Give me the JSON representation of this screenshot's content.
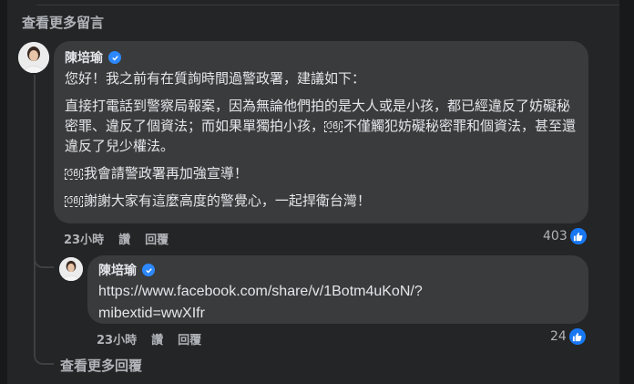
{
  "header": {
    "view_more_comments": "查看更多留言"
  },
  "comment": {
    "author": "陳培瑜",
    "greeting": "您好！我之前有在質詢時間過警政署，建議如下：",
    "para1": "直接打電話到警察局報案，因為無論他們拍的是大人或是小孩，都已經違反了妨礙秘密罪、違反了個資法；而如果單獨拍小孩，",
    "para1_tail": "不僅觸犯妨礙秘密罪和個資法，甚至還違反了兒少權法。",
    "para2": "我會請警政署再加強宣導！",
    "para3": "謝謝大家有這麼高度的警覺心，一起捍衛台灣！",
    "ob_glyph": "OBJ",
    "time": "23小時",
    "like_label": "讚",
    "reply_label": "回覆",
    "reaction_count": "403"
  },
  "reply": {
    "author": "陳培瑜",
    "link_line1": "https://www.facebook.com/share/v/1Botm4uKoN/?",
    "link_line2": "mibextid=wwXIfr",
    "time": "23小時",
    "like_label": "讚",
    "reply_label": "回覆",
    "reaction_count": "24"
  },
  "footer": {
    "view_more_replies": "查看更多回覆"
  },
  "colors": {
    "bubble": "#3a3b3c",
    "background": "#242526",
    "accent": "#1877f2",
    "muted": "#b0b3b8"
  }
}
